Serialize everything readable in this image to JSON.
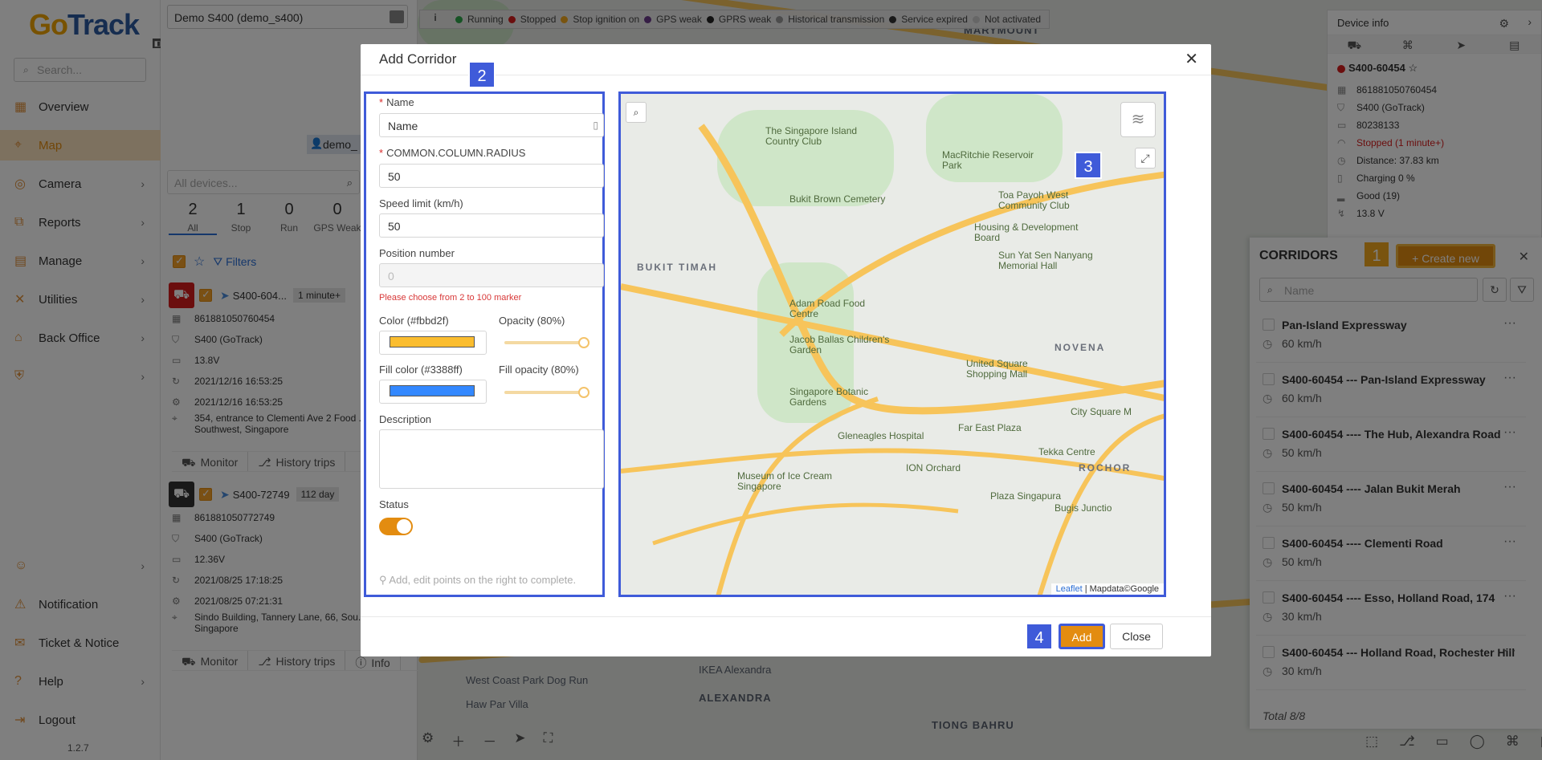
{
  "sidebar": {
    "logo_left": "Go",
    "logo_right": "Track",
    "search_placeholder": "Search...",
    "items": [
      {
        "label": "Overview",
        "icon": "overview-icon",
        "glyph": "▦",
        "arrow": false
      },
      {
        "label": "Map",
        "icon": "map-icon",
        "glyph": "⌖",
        "arrow": false
      },
      {
        "label": "Camera",
        "icon": "camera-icon",
        "glyph": "◎",
        "arrow": true
      },
      {
        "label": "Reports",
        "icon": "reports-icon",
        "glyph": "⧉",
        "arrow": true
      },
      {
        "label": "Manage",
        "icon": "manage-icon",
        "glyph": "▤",
        "arrow": true
      },
      {
        "label": "Utilities",
        "icon": "utilities-icon",
        "glyph": "✕",
        "arrow": true
      },
      {
        "label": "Back Office",
        "icon": "back-office-icon",
        "glyph": "⌂",
        "arrow": true
      },
      {
        "label": "",
        "icon": "shield-icon",
        "glyph": "⛨",
        "arrow": true
      }
    ],
    "bottom_items": [
      {
        "label": "",
        "icon": "user-icon",
        "glyph": "☺",
        "arrow": true
      },
      {
        "label": "Notification",
        "icon": "bell-icon",
        "glyph": "⚠",
        "arrow": false
      },
      {
        "label": "Ticket & Notice",
        "icon": "ticket-icon",
        "glyph": "✉",
        "arrow": false
      },
      {
        "label": "Help",
        "icon": "help-icon",
        "glyph": "?",
        "arrow": true
      },
      {
        "label": "Logout",
        "icon": "logout-icon",
        "glyph": "⇥",
        "arrow": false
      }
    ],
    "version": "1.2.7"
  },
  "device_panel": {
    "selected_device": "Demo S400 (demo_s400)",
    "user_chip": "demo_",
    "all_devices_placeholder": "All devices...",
    "counts": [
      {
        "n": "2",
        "label": "All"
      },
      {
        "n": "1",
        "label": "Stop"
      },
      {
        "n": "0",
        "label": "Run"
      },
      {
        "n": "0",
        "label": "GPS Weak"
      }
    ],
    "filters_label": "Filters",
    "devices": [
      {
        "name": "S400-604...",
        "badge": "1 minute+",
        "color": "#d61d1d",
        "rows": [
          "861881050760454",
          "S400 (GoTrack)",
          "13.8V",
          "2021/12/16 16:53:25",
          "2021/12/16 16:53:25",
          "354, entrance to Clementi Ave 2 Food ... Southwest, Singapore"
        ],
        "tabs": [
          "Monitor",
          "History trips"
        ]
      },
      {
        "name": "S400-72749",
        "badge": "112 day",
        "color": "#333333",
        "rows": [
          "861881050772749",
          "S400 (GoTrack)",
          "12.36V",
          "2021/08/25 17:18:25",
          "2021/08/25 07:21:31",
          "Sindo Building, Tannery Lane, 66, Sou... Singapore"
        ],
        "tabs": [
          "Monitor",
          "History trips",
          "Info"
        ]
      }
    ]
  },
  "legend": [
    {
      "label": "Running",
      "color": "#2ea64a"
    },
    {
      "label": "Stopped",
      "color": "#d61d1d"
    },
    {
      "label": "Stop ignition on",
      "color": "#f2a91e"
    },
    {
      "label": "GPS weak",
      "color": "#6b3a8a"
    },
    {
      "label": "GPRS weak",
      "color": "#222222"
    },
    {
      "label": "Historical transmission",
      "color": "#999999"
    },
    {
      "label": "Service expired",
      "color": "#333333"
    },
    {
      "label": "Not activated",
      "color": "#cccccc"
    }
  ],
  "device_info": {
    "title": "Device info",
    "name": "S400-60454",
    "rows": [
      {
        "icon": "imei-icon",
        "text": "861881050760454",
        "color": "#333"
      },
      {
        "icon": "tag-icon",
        "text": "S400 (GoTrack)",
        "color": "#333"
      },
      {
        "icon": "sim-icon",
        "text": "80238133",
        "color": "#333"
      },
      {
        "icon": "status-icon",
        "text": "Stopped  (1 minute+)",
        "color": "#d61d1d"
      },
      {
        "icon": "distance-icon",
        "text": "Distance: 37.83 km",
        "color": "#333"
      },
      {
        "icon": "battery-icon",
        "text": "Charging 0 %",
        "color": "#333"
      },
      {
        "icon": "signal-icon",
        "text": "Good (19)",
        "color": "#333"
      },
      {
        "icon": "voltage-icon",
        "text": "13.8 V",
        "color": "#333"
      }
    ]
  },
  "corridors": {
    "title": "CORRIDORS",
    "create_label": "+ Create new",
    "search_placeholder": "Name",
    "items": [
      {
        "name": "Pan-Island Expressway",
        "speed": "60 km/h"
      },
      {
        "name": "S400-60454 --- Pan-Island Expressway",
        "speed": "60 km/h"
      },
      {
        "name": "S400-60454 ---- The Hub, Alexandra Road",
        "speed": "50 km/h"
      },
      {
        "name": "S400-60454 ---- Jalan Bukit Merah",
        "speed": "50 km/h"
      },
      {
        "name": "S400-60454 ---- Clementi Road",
        "speed": "50 km/h"
      },
      {
        "name": "S400-60454 ---- Esso, Holland Road, 174",
        "speed": "30 km/h"
      },
      {
        "name": "S400-60454 --- Holland Road, Rochester Hill",
        "speed": "30 km/h"
      }
    ],
    "total": "Total 8/8"
  },
  "modal": {
    "title": "Add Corridor",
    "name_label": "Name",
    "name_value": "Name",
    "radius_label": "COMMON.COLUMN.RADIUS",
    "radius_value": "50",
    "speed_label": "Speed limit (km/h)",
    "speed_value": "50",
    "position_label": "Position number",
    "position_value": "0",
    "error_text": "Please choose from 2 to 100 marker",
    "color_label": "Color (#fbbd2f)",
    "color_value": "#fbbd2f",
    "opacity_label": "Opacity (80%)",
    "opacity": 0.8,
    "fill_color_label": "Fill color (#3388ff)",
    "fill_color_value": "#3388ff",
    "fill_opacity_label": "Fill opacity (80%)",
    "fill_opacity": 0.8,
    "description_label": "Description",
    "status_label": "Status",
    "status_on": true,
    "hint": "Add, edit points on the right to complete.",
    "add_label": "Add",
    "close_label": "Close",
    "map_attribution_leaflet": "Leaflet",
    "map_attribution_rest": "| Mapdata©Google",
    "map_labels": [
      "The Singapore Island Country Club",
      "MacRitchie Reservoir Park",
      "Bukit Brown Cemetery",
      "Toa Payoh West Community Club",
      "Housing & Development Board",
      "Sun Yat Sen Nanyang Memorial Hall",
      "BUKIT TIMAH",
      "Adam Road Food Centre",
      "Jacob Ballas Children's Garden",
      "NOVENA",
      "United Square Shopping Mall",
      "Singapore Botanic Gardens",
      "Gleneagles Hospital",
      "Far East Plaza",
      "City Square M",
      "Tekka Centre",
      "Museum of Ice Cream Singapore",
      "ION Orchard",
      "Plaza Singapura",
      "Bugis Junctio",
      "ROCHOR"
    ]
  },
  "steps": [
    "1",
    "2",
    "3",
    "4"
  ],
  "map_bg_labels": [
    "MARYMOUNT",
    "West Coast Park Dog Run",
    "IKEA Alexandra",
    "Haw Par Villa",
    "ALEXANDRA",
    "TIONG BAHRU"
  ]
}
